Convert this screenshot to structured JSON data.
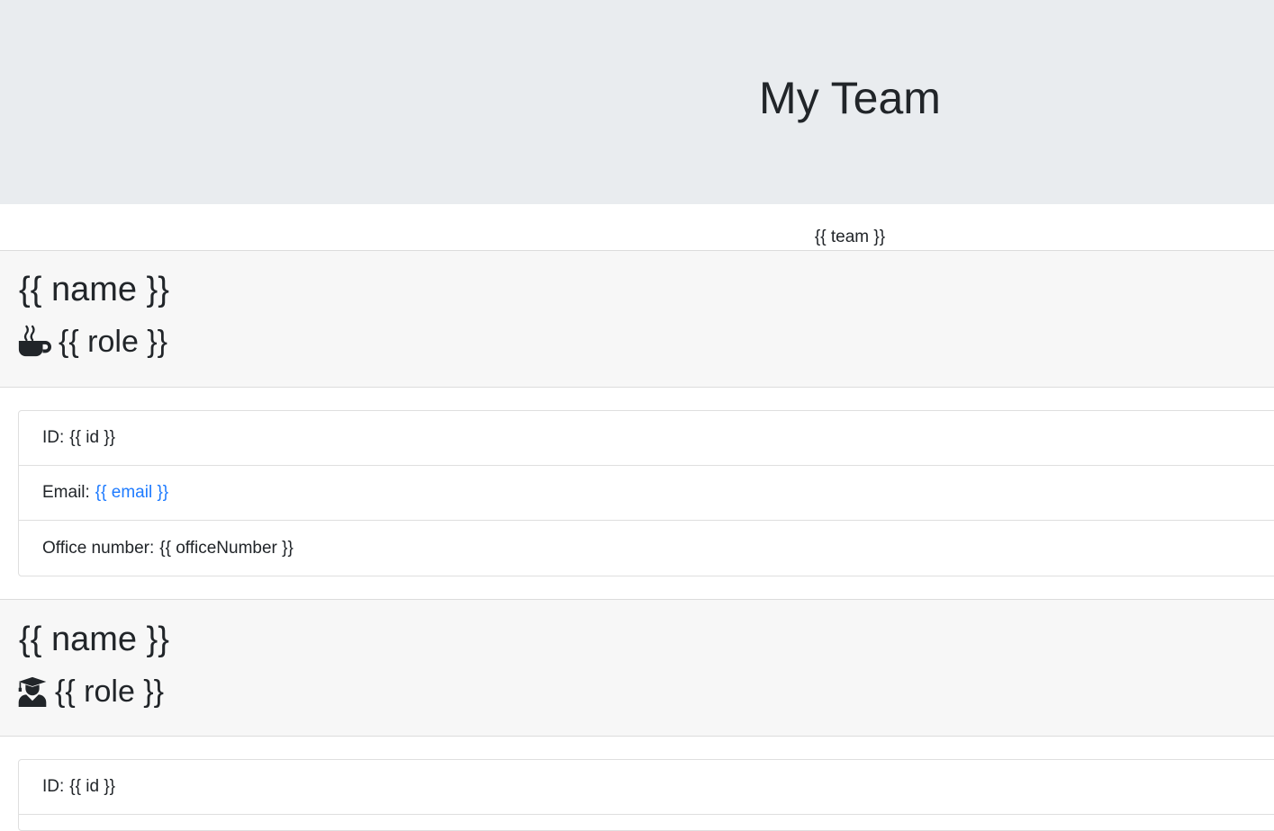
{
  "header": {
    "title": "My Team"
  },
  "team_placeholder": "{{ team }}",
  "cards": [
    {
      "name": "{{ name }}",
      "role": "{{ role }}",
      "role_icon": "coffee-icon",
      "fields": {
        "id_label": "ID:",
        "id_value": "{{ id }}",
        "email_label": "Email:",
        "email_value": "{{ email }}",
        "office_label": "Office number:",
        "office_value": "{{ officeNumber }}"
      }
    },
    {
      "name": "{{ name }}",
      "role": "{{ role }}",
      "role_icon": "graduate-icon",
      "fields": {
        "id_label": "ID:",
        "id_value": "{{ id }}"
      }
    }
  ],
  "colors": {
    "header_bg": "#e9ecef",
    "card_header_bg": "#f7f7f7",
    "link": "#1e7bff",
    "text": "#212529"
  }
}
